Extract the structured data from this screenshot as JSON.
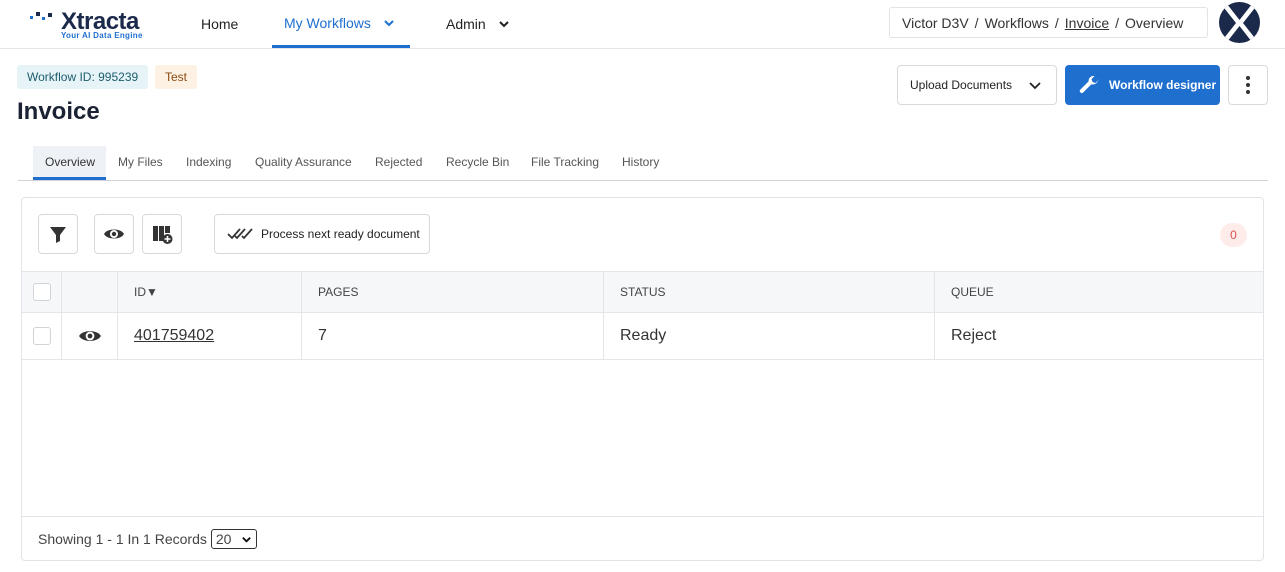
{
  "app": {
    "logo_name": "Xtracta",
    "logo_tagline": "Your AI Data Engine"
  },
  "nav": {
    "home": "Home",
    "my_workflows": "My Workflows",
    "admin": "Admin"
  },
  "breadcrumb": {
    "user": "Victor D3V",
    "sep": "/",
    "workflows": "Workflows",
    "invoice": "Invoice",
    "overview": "Overview"
  },
  "header": {
    "workflow_id": "Workflow ID: 995239",
    "env_badge": "Test",
    "title": "Invoice",
    "upload_label": "Upload Documents",
    "designer_label": "Workflow designer"
  },
  "tabs": [
    "Overview",
    "My Files",
    "Indexing",
    "Quality Assurance",
    "Rejected",
    "Recycle Bin",
    "File Tracking",
    "History"
  ],
  "toolbar": {
    "process_label": "Process next ready document",
    "count": "0"
  },
  "table": {
    "columns": {
      "id": "ID▼",
      "pages": "PAGES",
      "status": "STATUS",
      "queue": "QUEUE"
    },
    "rows": [
      {
        "id": "401759402",
        "pages": "7",
        "status": "Ready",
        "queue": "Reject"
      }
    ]
  },
  "footer": {
    "showing": "Showing 1 - 1 In 1 Records",
    "page_size": "20"
  },
  "colors": {
    "accent": "#1f6fcf",
    "brand_dark": "#1b2a4a"
  }
}
